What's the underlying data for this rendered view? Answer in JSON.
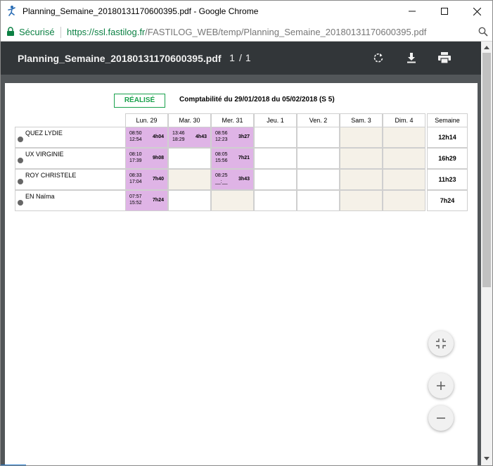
{
  "window": {
    "title": "Planning_Semaine_20180131170600395.pdf - Google Chrome",
    "minimize_icon": "minimize-icon",
    "maximize_icon": "maximize-icon",
    "close_icon": "close-icon"
  },
  "address": {
    "secure_label": "Sécurisé",
    "url_domain": "https://ssl.fastilog.fr",
    "url_path": "/FASTILOG_WEB/temp/Planning_Semaine_20180131170600395.pdf"
  },
  "pdf": {
    "file_name": "Planning_Semaine_20180131170600395.pdf",
    "current_page": "1",
    "page_separator": "/",
    "total_pages": "1"
  },
  "document": {
    "status_badge": "RÉALISÉ",
    "period_title": "Comptabilité du 29/01/2018 du 05/02/2018 (S 5)",
    "days": [
      "Lun. 29",
      "Mar. 30",
      "Mer. 31",
      "Jeu. 1",
      "Ven. 2",
      "Sam. 3",
      "Dim. 4"
    ],
    "week_header": "Semaine",
    "rows": [
      {
        "name": "QUEZ LYDIE",
        "cells": [
          {
            "start": "08:50",
            "end": "12:54",
            "dur": "4h04"
          },
          {
            "start": "13:46",
            "end": "18:29",
            "dur": "4h43"
          },
          {
            "start": "08:56",
            "end": "12:23",
            "dur": "3h27"
          },
          {
            "start": "",
            "end": "",
            "dur": ""
          },
          {
            "start": "",
            "end": "",
            "dur": ""
          },
          {
            "start": "",
            "end": "",
            "dur": ""
          },
          {
            "start": "",
            "end": "",
            "dur": ""
          }
        ],
        "week_total": "12h14"
      },
      {
        "name": "UX VIRGINIE",
        "cells": [
          {
            "start": "08:10",
            "end": "17:39",
            "dur": "9h08"
          },
          {
            "start": "",
            "end": "",
            "dur": ""
          },
          {
            "start": "08:05",
            "end": "15:56",
            "dur": "7h21"
          },
          {
            "start": "",
            "end": "",
            "dur": ""
          },
          {
            "start": "",
            "end": "",
            "dur": ""
          },
          {
            "start": "",
            "end": "",
            "dur": ""
          },
          {
            "start": "",
            "end": "",
            "dur": ""
          }
        ],
        "week_total": "16h29"
      },
      {
        "name": "ROY CHRISTELE",
        "cells": [
          {
            "start": "08:33",
            "end": "17:04",
            "dur": "7h40"
          },
          {
            "start": "",
            "end": "",
            "dur": ""
          },
          {
            "start": "08:25",
            "end": "__:__",
            "dur": "3h43"
          },
          {
            "start": "",
            "end": "",
            "dur": ""
          },
          {
            "start": "",
            "end": "",
            "dur": ""
          },
          {
            "start": "",
            "end": "",
            "dur": ""
          },
          {
            "start": "",
            "end": "",
            "dur": ""
          }
        ],
        "week_total": "11h23"
      },
      {
        "name": "EN Naïma",
        "cells": [
          {
            "start": "07:57",
            "end": "15:52",
            "dur": "7h24"
          },
          {
            "start": "",
            "end": "",
            "dur": ""
          },
          {
            "start": "",
            "end": "",
            "dur": ""
          },
          {
            "start": "",
            "end": "",
            "dur": ""
          },
          {
            "start": "",
            "end": "",
            "dur": ""
          },
          {
            "start": "",
            "end": "",
            "dur": ""
          },
          {
            "start": "",
            "end": "",
            "dur": ""
          }
        ],
        "week_total": "7h24"
      }
    ]
  },
  "colors": {
    "worked_cell": "#dfb4e6",
    "tan_cell": "#f5f1e8",
    "badge_green": "#19a14c",
    "toolbar_bg": "#323639",
    "url_green": "#0b8043"
  }
}
